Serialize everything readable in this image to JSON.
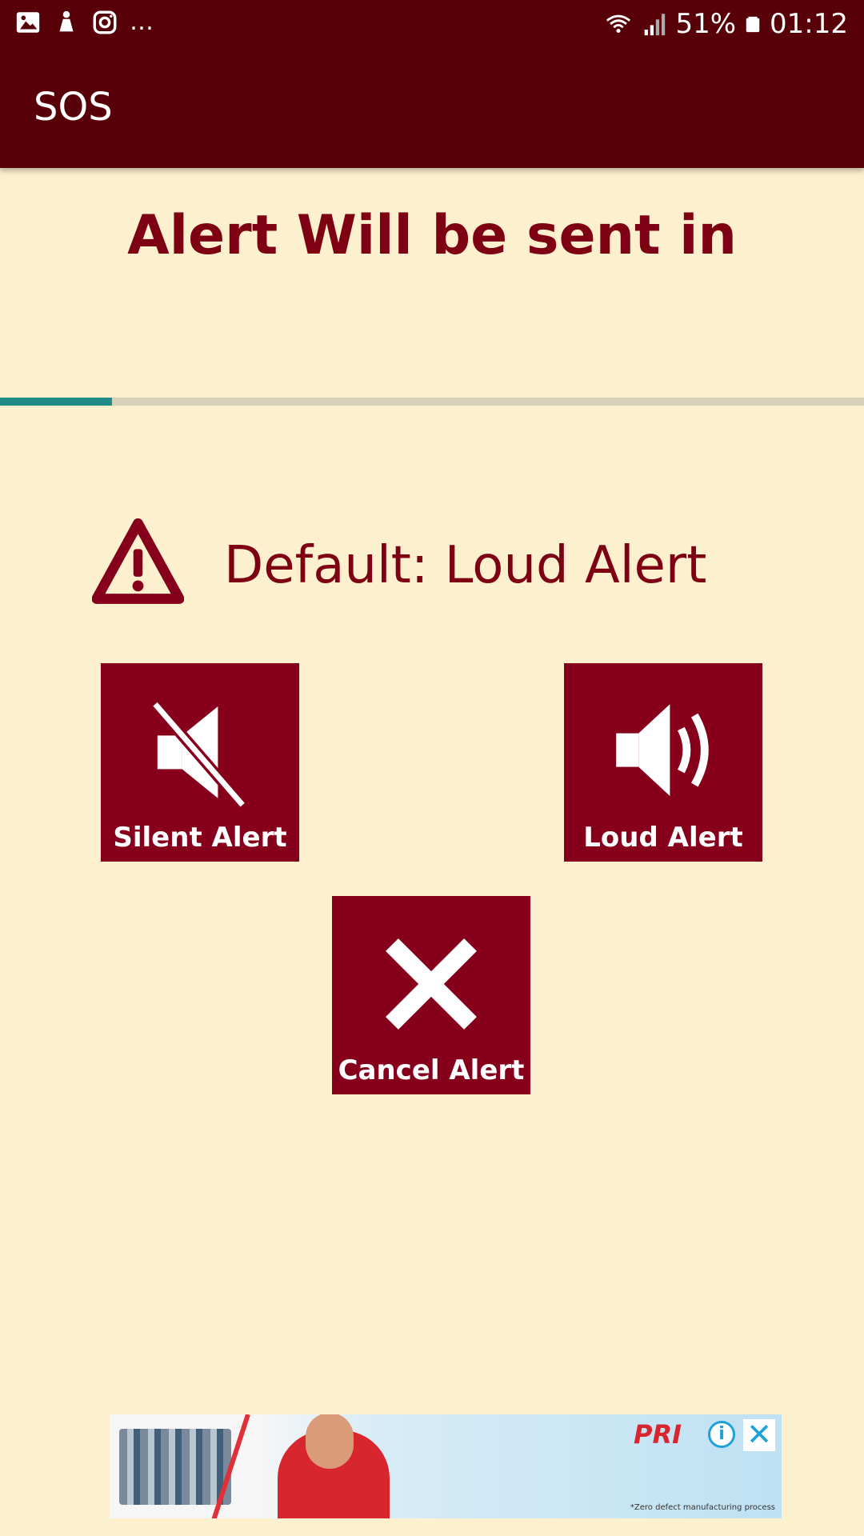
{
  "status_bar": {
    "battery": "51%",
    "time": "01:12",
    "left_icons": [
      "gallery-icon",
      "notification-icon",
      "instagram-icon",
      "more-icon"
    ],
    "right_icons": [
      "wifi-icon",
      "signal-icon",
      "battery-icon"
    ]
  },
  "app_bar": {
    "title": "SOS"
  },
  "countdown": {
    "heading": "Alert Will be sent in",
    "progress": 0.13
  },
  "default_mode": {
    "label": "Default: Loud Alert",
    "icon": "warning-icon"
  },
  "actions": {
    "silent": {
      "label": "Silent Alert",
      "icon": "speaker-mute-icon"
    },
    "loud": {
      "label": "Loud Alert",
      "icon": "speaker-loud-icon"
    },
    "cancel": {
      "label": "Cancel Alert",
      "icon": "close-icon"
    }
  },
  "ad": {
    "brand": "PRI",
    "info_glyph": "i",
    "close_glyph": "✕",
    "fine_print": "*Zero defect manufacturing process"
  },
  "colors": {
    "app_bar": "#570007",
    "accent": "#86001c",
    "background": "#fdf0cf",
    "progress": "#1f8a86"
  }
}
